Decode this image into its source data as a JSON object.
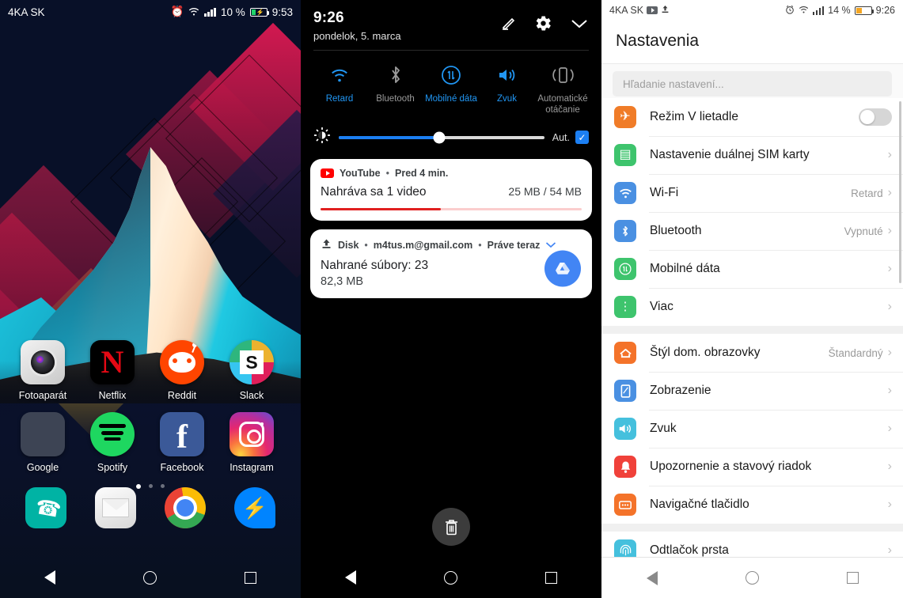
{
  "home": {
    "status": {
      "carrier": "4KA SK",
      "battery_pct": "10 %",
      "time": "9:53",
      "alarm_icon": "alarm-icon",
      "wifi_icon": "wifi-icon",
      "signal_icon": "signal-icon",
      "battery_icon": "battery-charging-icon"
    },
    "apps_row1": [
      {
        "label": "Fotoaparát",
        "icon": "camera-icon"
      },
      {
        "label": "Netflix",
        "icon": "netflix-icon",
        "glyph": "N"
      },
      {
        "label": "Reddit",
        "icon": "reddit-icon"
      },
      {
        "label": "Slack",
        "icon": "slack-icon",
        "glyph": "S"
      }
    ],
    "apps_row2": [
      {
        "label": "Google",
        "icon": "google-folder-icon"
      },
      {
        "label": "Spotify",
        "icon": "spotify-icon"
      },
      {
        "label": "Facebook",
        "icon": "facebook-icon",
        "glyph": "f"
      },
      {
        "label": "Instagram",
        "icon": "instagram-icon"
      }
    ],
    "page_dots": 3,
    "active_dot": 1,
    "dock": [
      {
        "name": "phone-icon",
        "glyph": "✆"
      },
      {
        "name": "email-icon"
      },
      {
        "name": "chrome-icon"
      },
      {
        "name": "messenger-icon",
        "glyph": "⚡"
      }
    ],
    "nav": {
      "back": "back-icon",
      "home": "home-icon",
      "recents": "recents-icon"
    }
  },
  "shade": {
    "time": "9:26",
    "date": "pondelok, 5. marca",
    "actions": [
      {
        "name": "edit-icon"
      },
      {
        "name": "settings-gear-icon"
      },
      {
        "name": "chevron-down-icon"
      }
    ],
    "quick_settings": [
      {
        "label": "Retard",
        "icon": "wifi-icon",
        "on": true
      },
      {
        "label": "Bluetooth",
        "icon": "bluetooth-icon",
        "on": false
      },
      {
        "label": "Mobilné dáta",
        "icon": "mobile-data-icon",
        "on": true
      },
      {
        "label": "Zvuk",
        "icon": "sound-icon",
        "on": true
      },
      {
        "label": "Automatické otáčanie",
        "icon": "auto-rotate-icon",
        "on": false
      }
    ],
    "brightness": {
      "icon": "brightness-icon",
      "value_pct": 49,
      "auto_label": "Aut.",
      "auto_checked": true,
      "check_glyph": "✓"
    },
    "notifications": [
      {
        "app": "YouTube",
        "app_icon": "youtube-icon",
        "time": "Pred 4 min.",
        "title": "Nahráva sa 1 video",
        "right": "25 MB / 54 MB",
        "progress_pct": 46,
        "separator": "•"
      },
      {
        "app": "Disk",
        "app_icon": "upload-icon",
        "account": "m4tus.m@gmail.com",
        "time": "Práve teraz",
        "title": "Nahrané súbory: 23",
        "subtitle": "82,3 MB",
        "expand_icon": "chevron-down-icon",
        "fab_icon": "google-drive-icon",
        "separator": "•"
      }
    ],
    "clear_all": {
      "name": "trash-icon",
      "glyph": "🗑"
    },
    "nav": {
      "back": "back-icon",
      "home": "home-icon",
      "recents": "recents-icon"
    }
  },
  "settings": {
    "status": {
      "carrier": "4KA SK",
      "yt_icon": "youtube-icon",
      "upload_icon": "upload-icon",
      "alarm_icon": "alarm-icon",
      "wifi_icon": "wifi-icon",
      "signal_icon": "signal-icon",
      "battery_pct": "14 %",
      "battery_icon": "battery-icon",
      "time": "9:26"
    },
    "title": "Nastavenia",
    "search_placeholder": "Hľadanie nastavení...",
    "groups": [
      {
        "rows": [
          {
            "label": "Režim V lietadle",
            "icon": "airplane-icon",
            "icon_class": "ico-plane",
            "glyph": "✈",
            "control": "toggle",
            "toggle_on": false
          },
          {
            "label": "Nastavenie duálnej SIM karty",
            "icon": "sim-card-icon",
            "icon_class": "ico-sim",
            "glyph": "▤",
            "control": "chevron",
            "value": ""
          },
          {
            "label": "Wi-Fi",
            "icon": "wifi-icon",
            "icon_class": "ico-wifi",
            "glyph": "◴",
            "control": "chevron",
            "value": "Retard"
          },
          {
            "label": "Bluetooth",
            "icon": "bluetooth-icon",
            "icon_class": "ico-bt",
            "glyph": "ᛦ",
            "control": "chevron",
            "value": "Vypnuté"
          },
          {
            "label": "Mobilné dáta",
            "icon": "mobile-data-icon",
            "icon_class": "ico-data",
            "glyph": "⇅",
            "control": "chevron",
            "value": ""
          },
          {
            "label": "Viac",
            "icon": "more-icon",
            "icon_class": "ico-more",
            "glyph": "⋮",
            "control": "chevron",
            "value": ""
          }
        ]
      },
      {
        "rows": [
          {
            "label": "Štýl dom. obrazovky",
            "icon": "home-style-icon",
            "icon_class": "ico-home",
            "glyph": "⌂",
            "control": "chevron",
            "value": "Štandardný"
          },
          {
            "label": "Zobrazenie",
            "icon": "display-icon",
            "icon_class": "ico-disp",
            "glyph": "□",
            "control": "chevron",
            "value": ""
          },
          {
            "label": "Zvuk",
            "icon": "sound-icon",
            "icon_class": "ico-snd",
            "glyph": "◁",
            "control": "chevron",
            "value": ""
          },
          {
            "label": "Upozornenie a stavový riadok",
            "icon": "bell-icon",
            "icon_class": "ico-bell",
            "glyph": "●",
            "control": "chevron",
            "value": ""
          },
          {
            "label": "Navigačné tlačidlo",
            "icon": "navigation-button-icon",
            "icon_class": "ico-nav",
            "glyph": "▣",
            "control": "chevron",
            "value": ""
          }
        ]
      },
      {
        "rows": [
          {
            "label": "Odtlačok prsta",
            "icon": "fingerprint-icon",
            "icon_class": "ico-fp",
            "glyph": "◎",
            "control": "chevron",
            "value": ""
          }
        ]
      }
    ],
    "chevron_glyph": "›",
    "nav": {
      "back": "back-icon",
      "home": "home-icon",
      "recents": "recents-icon"
    }
  }
}
